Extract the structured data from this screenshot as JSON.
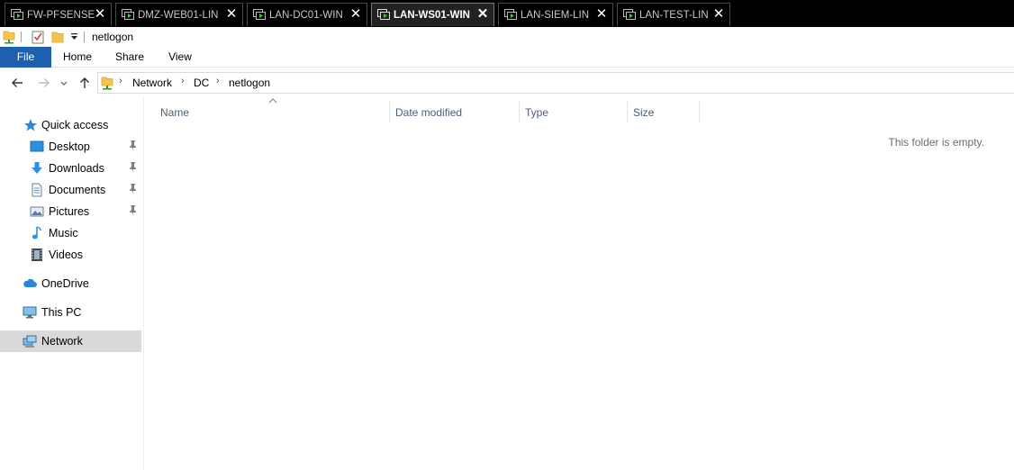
{
  "vm_tabs": [
    {
      "label": "FW-PFSENSE",
      "active": false
    },
    {
      "label": "DMZ-WEB01-LIN",
      "active": false
    },
    {
      "label": "LAN-DC01-WIN",
      "active": false
    },
    {
      "label": "LAN-WS01-WIN",
      "active": true
    },
    {
      "label": "LAN-SIEM-LIN",
      "active": false
    },
    {
      "label": "LAN-TEST-LIN",
      "active": false
    }
  ],
  "vm_tab_close_glyph": "✕",
  "window": {
    "title": "netlogon"
  },
  "ribbon": {
    "file": "File",
    "home": "Home",
    "share": "Share",
    "view": "View"
  },
  "breadcrumb": [
    "Network",
    "DC",
    "netlogon"
  ],
  "breadcrumb_separator": "›",
  "sidebar": {
    "quick_access": "Quick access",
    "desktop": "Desktop",
    "downloads": "Downloads",
    "documents": "Documents",
    "pictures": "Pictures",
    "music": "Music",
    "videos": "Videos",
    "onedrive": "OneDrive",
    "this_pc": "This PC",
    "network": "Network"
  },
  "columns": {
    "name": "Name",
    "date_modified": "Date modified",
    "type": "Type",
    "size": "Size"
  },
  "empty_message": "This folder is empty.",
  "colors": {
    "file_tab": "#1e60b0",
    "selected_nav": "#d9d9d9",
    "column_header_text": "#4c607a"
  }
}
